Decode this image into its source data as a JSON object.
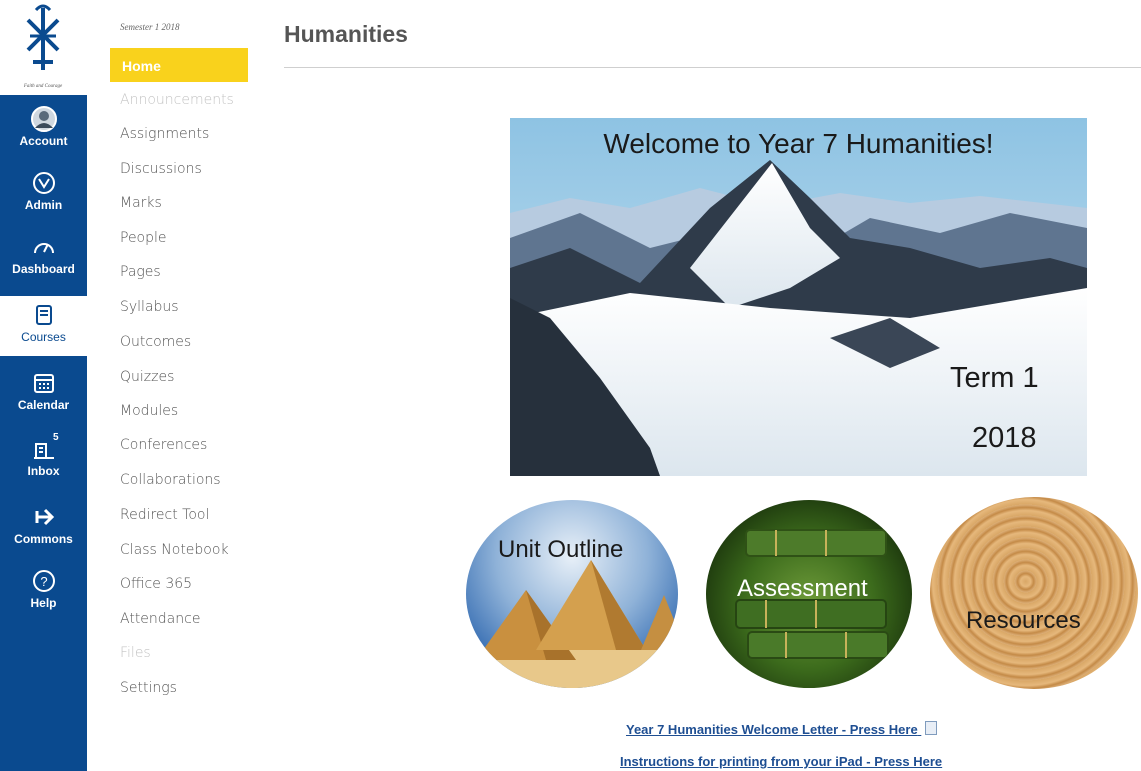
{
  "global_nav": {
    "logo_caption": "Faith and Courage",
    "items": [
      {
        "label": "Account",
        "icon": "avatar"
      },
      {
        "label": "Admin",
        "icon": "shield-icon"
      },
      {
        "label": "Dashboard",
        "icon": "speedometer-icon"
      },
      {
        "label": "Courses",
        "icon": "book-icon"
      },
      {
        "label": "Calendar",
        "icon": "calendar-icon"
      },
      {
        "label": "Inbox",
        "icon": "inbox-icon",
        "badge": "5"
      },
      {
        "label": "Commons",
        "icon": "arrow-right-icon"
      },
      {
        "label": "Help",
        "icon": "help-icon"
      }
    ]
  },
  "course_nav": {
    "semester": "Semester 1 2018",
    "items": [
      {
        "label": "Home"
      },
      {
        "label": "Announcements"
      },
      {
        "label": "Assignments"
      },
      {
        "label": "Discussions"
      },
      {
        "label": "Marks"
      },
      {
        "label": "People"
      },
      {
        "label": "Pages"
      },
      {
        "label": "Syllabus"
      },
      {
        "label": "Outcomes"
      },
      {
        "label": "Quizzes"
      },
      {
        "label": "Modules"
      },
      {
        "label": "Conferences"
      },
      {
        "label": "Collaborations"
      },
      {
        "label": "Redirect Tool"
      },
      {
        "label": "Class Notebook"
      },
      {
        "label": "Office 365"
      },
      {
        "label": "Attendance"
      },
      {
        "label": "Files"
      },
      {
        "label": "Settings"
      }
    ]
  },
  "header": {
    "title": "Humanities"
  },
  "banner": {
    "title": "Welcome to Year 7 Humanities!",
    "term": "Term 1",
    "year": "2018"
  },
  "tiles": [
    {
      "label": "Unit Outline"
    },
    {
      "label": "Assessment"
    },
    {
      "label": "Resources"
    }
  ],
  "links": [
    {
      "text": "Year 7 Humanities Welcome Letter - Press Here"
    },
    {
      "text": "Instructions for printing from your iPad - Press Here"
    }
  ],
  "colors": {
    "nav": "#0a4a8f",
    "active_course": "#f9d21c",
    "link": "#1e4e92"
  }
}
